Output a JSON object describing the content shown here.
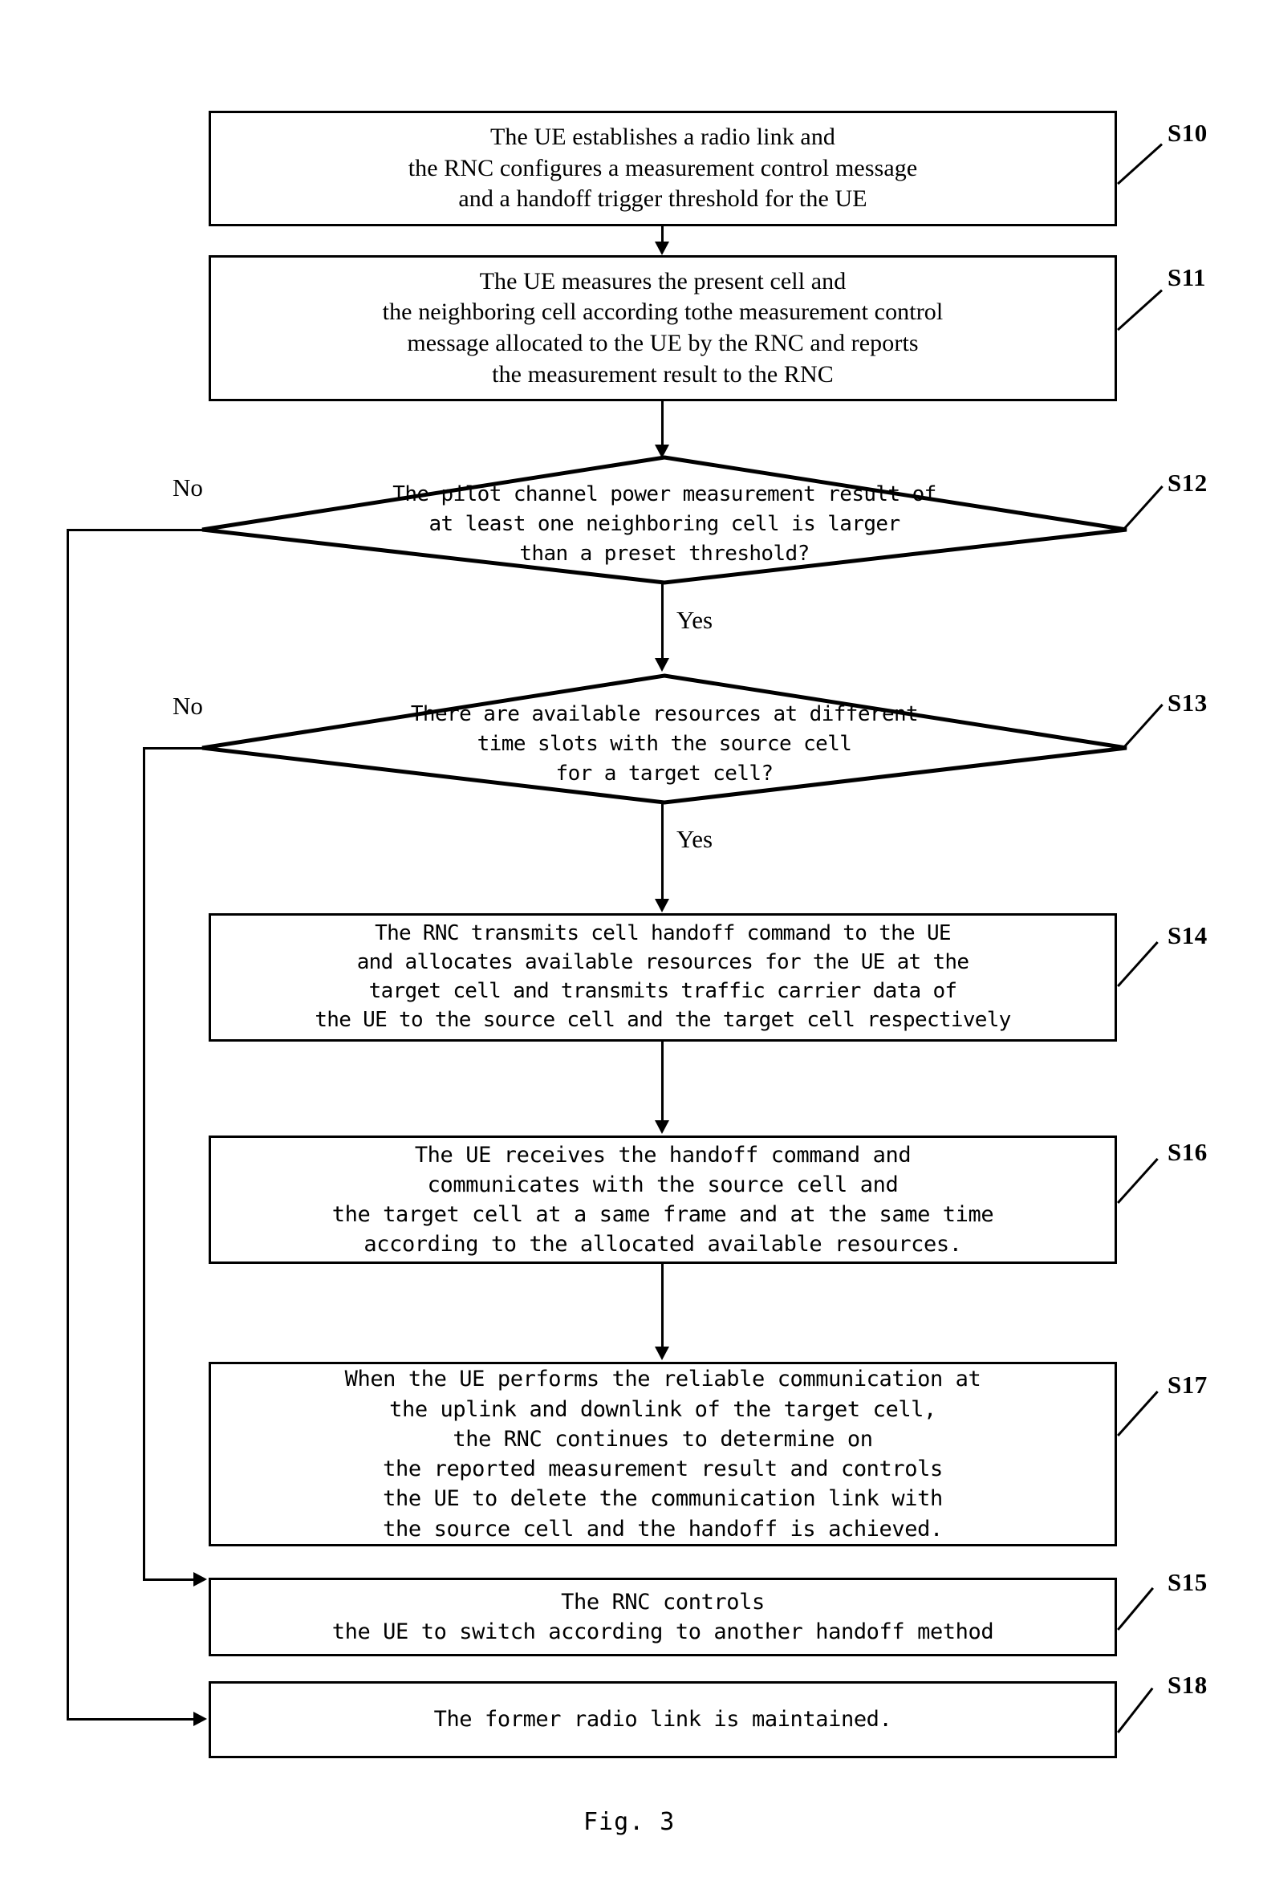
{
  "figure": {
    "caption": "Fig. 3"
  },
  "branch_labels": {
    "no_s12": "No",
    "yes_s12": "Yes",
    "no_s13": "No",
    "yes_s13": "Yes"
  },
  "nodes": [
    {
      "id": "S10",
      "type": "process",
      "ref": "S10",
      "lines": [
        "The UE establishes a radio link and",
        "the RNC configures a measurement control message",
        "and a handoff trigger threshold for the UE"
      ]
    },
    {
      "id": "S11",
      "type": "process",
      "ref": "S11",
      "lines": [
        "The UE measures the present cell and",
        "the neighboring cell according tothe measurement control",
        "message allocated to the UE by the RNC and reports",
        "the measurement result to the RNC"
      ]
    },
    {
      "id": "S12",
      "type": "decision",
      "ref": "S12",
      "lines": [
        "The pilot channel power measurement result of",
        "at least one neighboring cell is larger",
        "than a preset threshold?"
      ]
    },
    {
      "id": "S13",
      "type": "decision",
      "ref": "S13",
      "lines": [
        "There are available resources at different",
        "time slots with the source cell",
        "for a target cell?"
      ]
    },
    {
      "id": "S14",
      "type": "process",
      "ref": "S14",
      "lines": [
        "The RNC transmits cell handoff command to the UE",
        "and allocates available resources for the UE at the",
        "target cell and transmits traffic carrier data of",
        "the UE to the source cell and the target cell respectively"
      ]
    },
    {
      "id": "S16",
      "type": "process",
      "ref": "S16",
      "lines": [
        "The UE receives the handoff command and",
        "communicates with the source cell and",
        "the target cell at a same frame and at the same time",
        "according to the allocated available resources."
      ]
    },
    {
      "id": "S17",
      "type": "process",
      "ref": "S17",
      "lines": [
        "When the UE performs the reliable communication at",
        "the uplink and downlink of the target cell,",
        "the RNC continues to determine on",
        "the reported measurement result and controls",
        "the UE to delete the communication link with",
        "the source cell and the handoff is achieved."
      ]
    },
    {
      "id": "S15",
      "type": "process",
      "ref": "S15",
      "lines": [
        "The RNC controls",
        "the UE to switch according to another handoff method"
      ]
    },
    {
      "id": "S18",
      "type": "process",
      "ref": "S18",
      "lines": [
        "The former radio link is maintained."
      ]
    }
  ],
  "refs": {
    "s10": "S10",
    "s11": "S11",
    "s12": "S12",
    "s13": "S13",
    "s14": "S14",
    "s15": "S15",
    "s16": "S16",
    "s17": "S17",
    "s18": "S18"
  },
  "colors": {
    "stroke": "#000000",
    "background": "#ffffff"
  }
}
